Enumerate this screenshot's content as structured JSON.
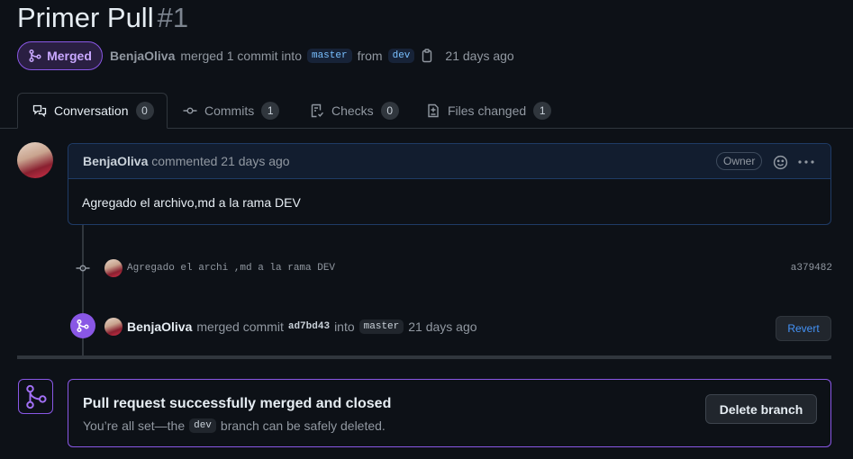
{
  "header": {
    "title": "Primer Pull",
    "number": "#1",
    "status_label": "Merged",
    "author": "BenjaOliva",
    "merged_text": "merged 1 commit into",
    "base_branch": "master",
    "from_text": "from",
    "head_branch": "dev",
    "time": "21 days ago"
  },
  "tabs": [
    {
      "label": "Conversation",
      "count": "0",
      "icon": "comment-discussion-icon"
    },
    {
      "label": "Commits",
      "count": "1",
      "icon": "git-commit-icon"
    },
    {
      "label": "Checks",
      "count": "0",
      "icon": "checklist-icon"
    },
    {
      "label": "Files changed",
      "count": "1",
      "icon": "file-diff-icon"
    }
  ],
  "comment": {
    "author": "BenjaOliva",
    "action": "commented 21 days ago",
    "role": "Owner",
    "body": "Agregado el archivo,md a la rama DEV"
  },
  "commit": {
    "message": "Agregado el archi ,md a la rama DEV",
    "sha": "a379482"
  },
  "merge_event": {
    "author": "BenjaOliva",
    "text": "merged commit",
    "sha": "ad7bd43",
    "into": "into",
    "branch": "master",
    "time": "21 days ago",
    "revert_label": "Revert"
  },
  "merged_box": {
    "title": "Pull request successfully merged and closed",
    "sub_before": "You’re all set—the",
    "branch": "dev",
    "sub_after": "branch can be safely deleted.",
    "delete_label": "Delete branch"
  },
  "colors": {
    "merged_purple": "#8957e5",
    "link_blue": "#4493f8",
    "background": "#0d1117"
  }
}
